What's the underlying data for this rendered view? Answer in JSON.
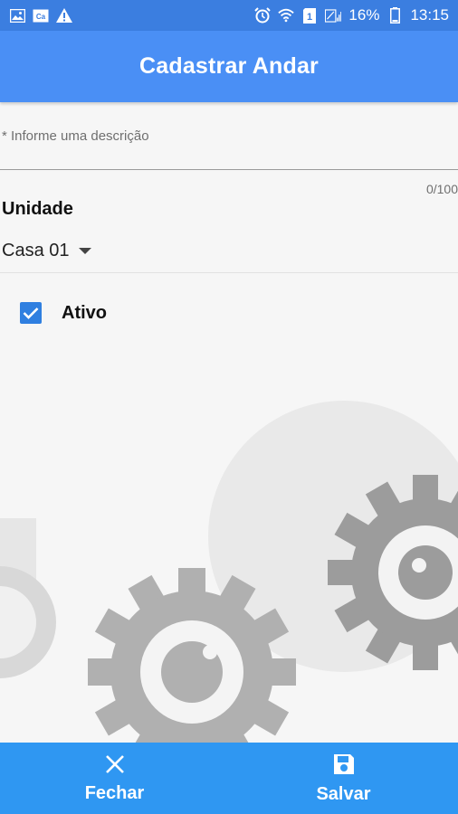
{
  "status_bar": {
    "battery": "16%",
    "time": "13:15",
    "sim_badge": "1",
    "left_icons": [
      "image-icon",
      "cast-icon",
      "warning-icon"
    ],
    "right_icons": [
      "alarm-icon",
      "wifi-icon",
      "sim-icon",
      "signal-icon",
      "battery-icon"
    ]
  },
  "header": {
    "title": "Cadastrar Andar"
  },
  "form": {
    "description": {
      "placeholder": "* Informe uma descrição",
      "value": "",
      "counter": "0/100"
    },
    "unit": {
      "label": "Unidade",
      "selected": "Casa 01"
    },
    "active": {
      "label": "Ativo",
      "checked": true
    }
  },
  "actions": {
    "close": {
      "label": "Fechar",
      "icon": "close-icon"
    },
    "save": {
      "label": "Salvar",
      "icon": "save-icon"
    }
  },
  "colors": {
    "status_bar": "#3b7ee0",
    "app_bar": "#4a8ff5",
    "bottom_bar": "#2f97f2",
    "checkbox": "#2f7fe0",
    "background": "#f6f6f6"
  }
}
